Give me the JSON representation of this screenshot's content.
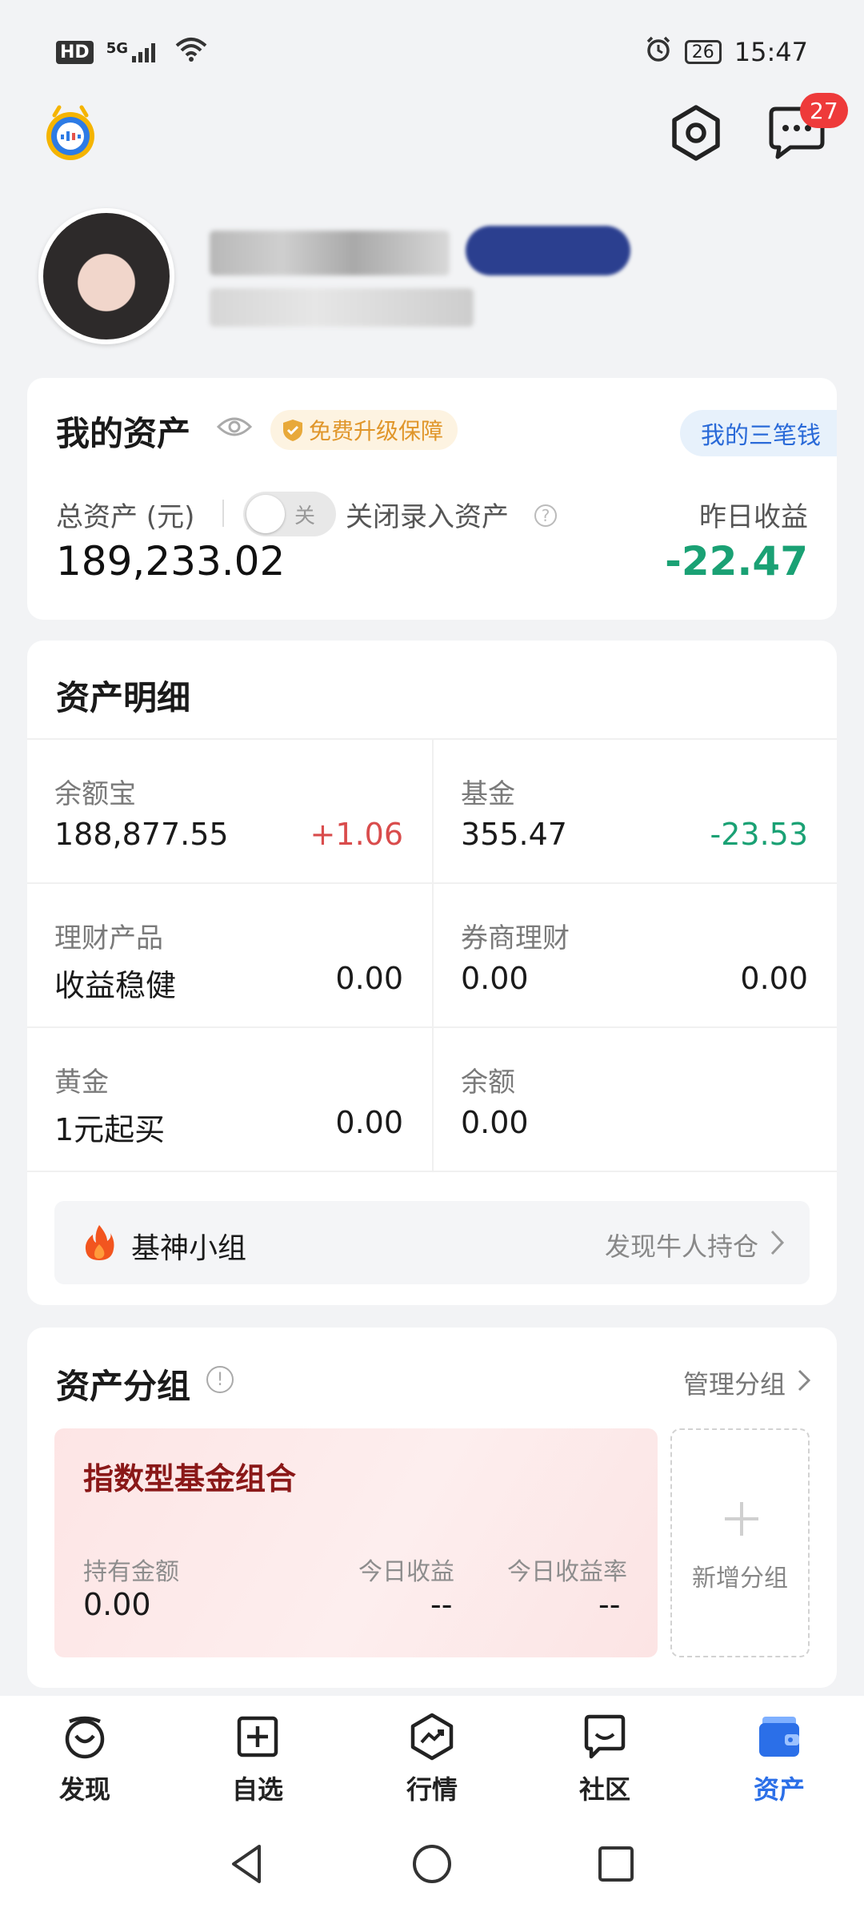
{
  "status_bar": {
    "network": "HD",
    "signal": "5G",
    "battery": "26",
    "time": "15:47"
  },
  "header": {
    "message_badge": "27"
  },
  "assets_card": {
    "title": "我的资产",
    "upgrade_badge": "免费升级保障",
    "three_money_link": "我的三笔钱",
    "total_label": "总资产 (元)",
    "toggle_state": "关",
    "toggle_label": "关闭录入资产",
    "total_value": "189,233.02",
    "yesterday_label": "昨日收益",
    "yesterday_value": "-22.47"
  },
  "detail_card": {
    "title": "资产明细",
    "items": [
      {
        "label": "余额宝",
        "value": "188,877.55",
        "change": "+1.06"
      },
      {
        "label": "基金",
        "value": "355.47",
        "change": "-23.53"
      },
      {
        "label": "理财产品",
        "value": "收益稳健",
        "change": "0.00"
      },
      {
        "label": "券商理财",
        "value": "0.00",
        "change": "0.00"
      },
      {
        "label": "黄金",
        "value": "1元起买",
        "change": "0.00"
      },
      {
        "label": "余额",
        "value": "0.00",
        "change": ""
      }
    ],
    "fund_group": {
      "title": "基神小组",
      "link": "发现牛人持仓"
    }
  },
  "group_card": {
    "title": "资产分组",
    "manage_link": "管理分组",
    "group": {
      "name": "指数型基金组合",
      "hold_label": "持有金额",
      "hold_value": "0.00",
      "today_label": "今日收益",
      "today_value": "--",
      "rate_label": "今日收益率",
      "rate_value": "--"
    },
    "add_label": "新增分组"
  },
  "tabbar": {
    "tabs": [
      {
        "label": "发现",
        "icon": "discover-icon"
      },
      {
        "label": "自选",
        "icon": "watchlist-icon"
      },
      {
        "label": "行情",
        "icon": "market-icon"
      },
      {
        "label": "社区",
        "icon": "community-icon"
      },
      {
        "label": "资产",
        "icon": "wallet-icon"
      }
    ],
    "active_index": 4,
    "accent_color": "#2b6fe8"
  },
  "colors": {
    "gain": "#d94c4c",
    "loss": "#1aa174",
    "badge": "#ee3a3a"
  }
}
